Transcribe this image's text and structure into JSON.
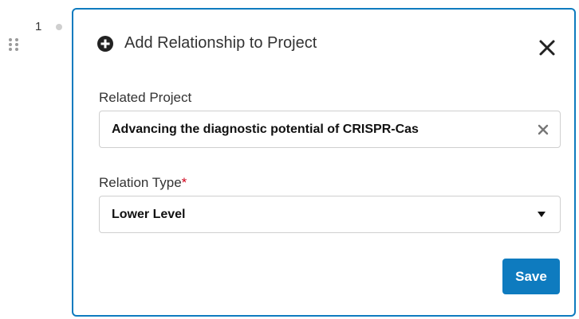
{
  "row": {
    "number": "1"
  },
  "dialog": {
    "title": "Add Relationship to Project",
    "icons": {
      "title_icon": "plus-circle-icon",
      "close_icon": "close-icon",
      "clear_icon": "clear-icon",
      "dropdown_icon": "caret-down-icon",
      "drag_icon": "drag-handle-icon"
    },
    "related_project": {
      "label": "Related Project",
      "value": "Advancing the diagnostic potential of CRISPR-Cas"
    },
    "relation_type": {
      "label": "Relation Type",
      "required_marker": "*",
      "selected": "Lower Level"
    },
    "save_label": "Save"
  },
  "colors": {
    "accent": "#0e7bbf",
    "required": "#d0021b",
    "border": "#cfcfcf",
    "text": "#333333"
  }
}
